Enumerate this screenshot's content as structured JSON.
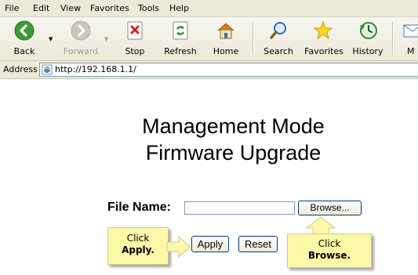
{
  "menu": [
    "File",
    "Edit",
    "View",
    "Favorites",
    "Tools",
    "Help"
  ],
  "toolbar": {
    "back": "Back",
    "forward": "Forward",
    "stop": "Stop",
    "refresh": "Refresh",
    "home": "Home",
    "search": "Search",
    "favorites": "Favorites",
    "history": "History",
    "mail_partial": "M"
  },
  "address": {
    "label": "Address",
    "url": "http://192.168.1.1/"
  },
  "page": {
    "title_line1": "Management Mode",
    "title_line2": "Firmware Upgrade",
    "file_label": "File Name:",
    "file_value": "",
    "browse_button": "Browse...",
    "apply_button": "Apply",
    "reset_button": "Reset"
  },
  "callouts": {
    "apply": {
      "line1": "Click",
      "line2": "Apply."
    },
    "browse": {
      "line1": "Click",
      "line2": "Browse."
    }
  },
  "colors": {
    "callout_bg": "#fdf7a8",
    "chrome": "#ece9d8"
  }
}
